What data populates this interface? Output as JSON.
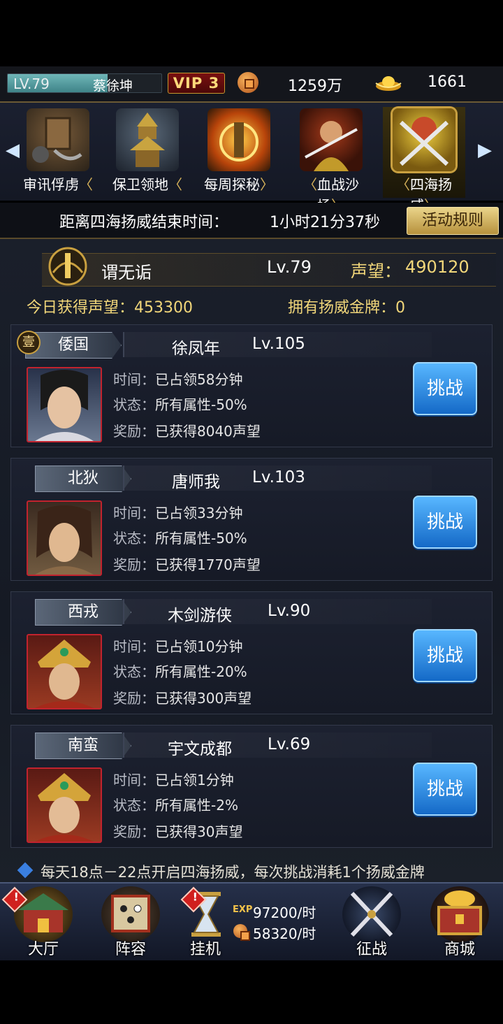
{
  "player": {
    "level": "LV.79",
    "level_progress": 0.65,
    "name": "蔡徐坤",
    "vip": "VIP 3",
    "coins": "1259万",
    "gold": "1661"
  },
  "tabs": [
    {
      "label": "审讯俘虏",
      "icon": "prisoner-interrogation-icon",
      "active": false
    },
    {
      "label": "保卫领地",
      "icon": "pagoda-tower-icon",
      "active": false
    },
    {
      "label": "每周探秘",
      "icon": "flaming-gate-icon",
      "active": false
    },
    {
      "label": "血战沙场",
      "icon": "warrior-general-icon",
      "active": false
    },
    {
      "label": "四海扬威",
      "icon": "crossed-swords-demon-icon",
      "active": true
    }
  ],
  "timer": {
    "label": "距离四海扬威结束时间：",
    "value": "1小时21分37秒",
    "rules_button": "活动规则"
  },
  "me": {
    "name": "谓无诟",
    "level": "Lv.79",
    "prestige_label": "声望：",
    "prestige": "490120",
    "today_prestige": "今日获得声望：453300",
    "medals": "拥有扬威金牌：0"
  },
  "labels": {
    "time": "时间：",
    "status": "状态：",
    "reward": "奖励：",
    "challenge": "挑战"
  },
  "occupants": [
    {
      "badge": "壹",
      "region": "倭国",
      "name": "徐凤年",
      "level": "Lv.105",
      "time": "已占领58分钟",
      "status": "所有属性-50%",
      "reward": "已获得8040声望"
    },
    {
      "badge": "",
      "region": "北狄",
      "name": "唐师我",
      "level": "Lv.103",
      "time": "已占领33分钟",
      "status": "所有属性-50%",
      "reward": "已获得1770声望"
    },
    {
      "badge": "",
      "region": "西戎",
      "name": "木剑游侠",
      "level": "Lv.90",
      "time": "已占领10分钟",
      "status": "所有属性-20%",
      "reward": "已获得300声望"
    },
    {
      "badge": "",
      "region": "南蛮",
      "name": "宇文成都",
      "level": "Lv.69",
      "time": "已占领1分钟",
      "status": "所有属性-2%",
      "reward": "已获得30声望"
    }
  ],
  "footnote": "每天18点－22点开启四海扬威，每次挑战消耗1个扬威金牌",
  "nav": [
    {
      "label": "大厅",
      "icon": "palace-hall-icon",
      "alert": true
    },
    {
      "label": "阵容",
      "icon": "formation-scroll-icon",
      "alert": false
    },
    {
      "label": "挂机",
      "icon": "hourglass-icon",
      "alert": true
    },
    {
      "label": "征战",
      "icon": "crossed-swords-icon",
      "alert": false
    },
    {
      "label": "商城",
      "icon": "treasure-chest-icon",
      "alert": false
    }
  ],
  "idle": {
    "exp_tag": "EXP",
    "exp_rate": "97200/时",
    "coin_rate": "58320/时"
  }
}
